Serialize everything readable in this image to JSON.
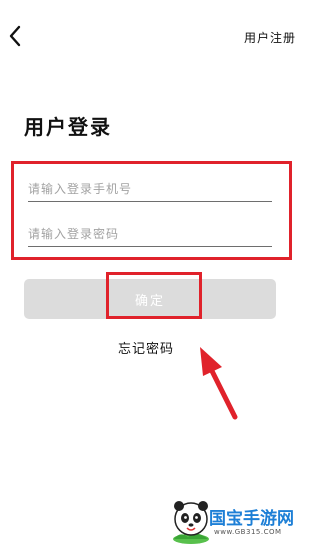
{
  "header": {
    "back_icon": "chevron-left-icon",
    "register_label": "用户注册"
  },
  "login": {
    "title": "用户登录",
    "phone_placeholder": "请输入登录手机号",
    "password_placeholder": "请输入登录密码",
    "confirm_label": "确定",
    "forgot_label": "忘记密码"
  },
  "annotation": {
    "highlight_color": "#e0222b",
    "arrow_icon": "arrow-up-left-icon"
  },
  "watermark": {
    "logo_icon": "panda-icon",
    "brand_text": "国宝手游网",
    "url_text": "www.GB315.COM"
  }
}
